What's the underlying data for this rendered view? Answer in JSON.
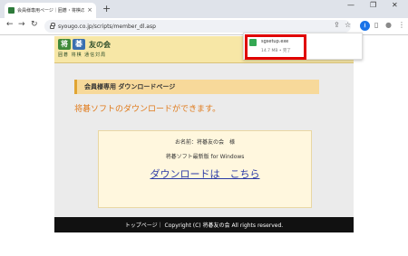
{
  "browser": {
    "tab_title": "会員様専用ページ｜囲碁・将棋の...",
    "tab_close": "×",
    "new_tab": "+",
    "min": "—",
    "max": "❐",
    "close": "✕",
    "back": "←",
    "forward": "→",
    "reload": "↻",
    "url": "syougo.co.jp/scripts/member_dl.asp",
    "share_icon": "⇪",
    "star_icon": "☆",
    "download_icon": "⭳",
    "sidepanel_icon": "▯",
    "profile_icon": "●",
    "menu_icon": "⋮"
  },
  "logo": {
    "char1": "将",
    "char2": "碁",
    "text": "友の会",
    "subtitle": "囲碁 将棋 通信対局"
  },
  "content": {
    "heading": "会員様専用 ダウンロードページ",
    "lead": "将碁ソフトのダウンロードができます。",
    "name_line": "お名前：将碁友の会　様",
    "version_line": "将碁ソフト最新版 for Windows",
    "download_link": "ダウンロードは　こちら"
  },
  "footer": {
    "text": "トップページ｜ Copyright (C) 将碁友の会 All rights reserved."
  },
  "download_bubble": {
    "filename": "sgsetup.exe",
    "status": "14.7 MB • 完了"
  }
}
